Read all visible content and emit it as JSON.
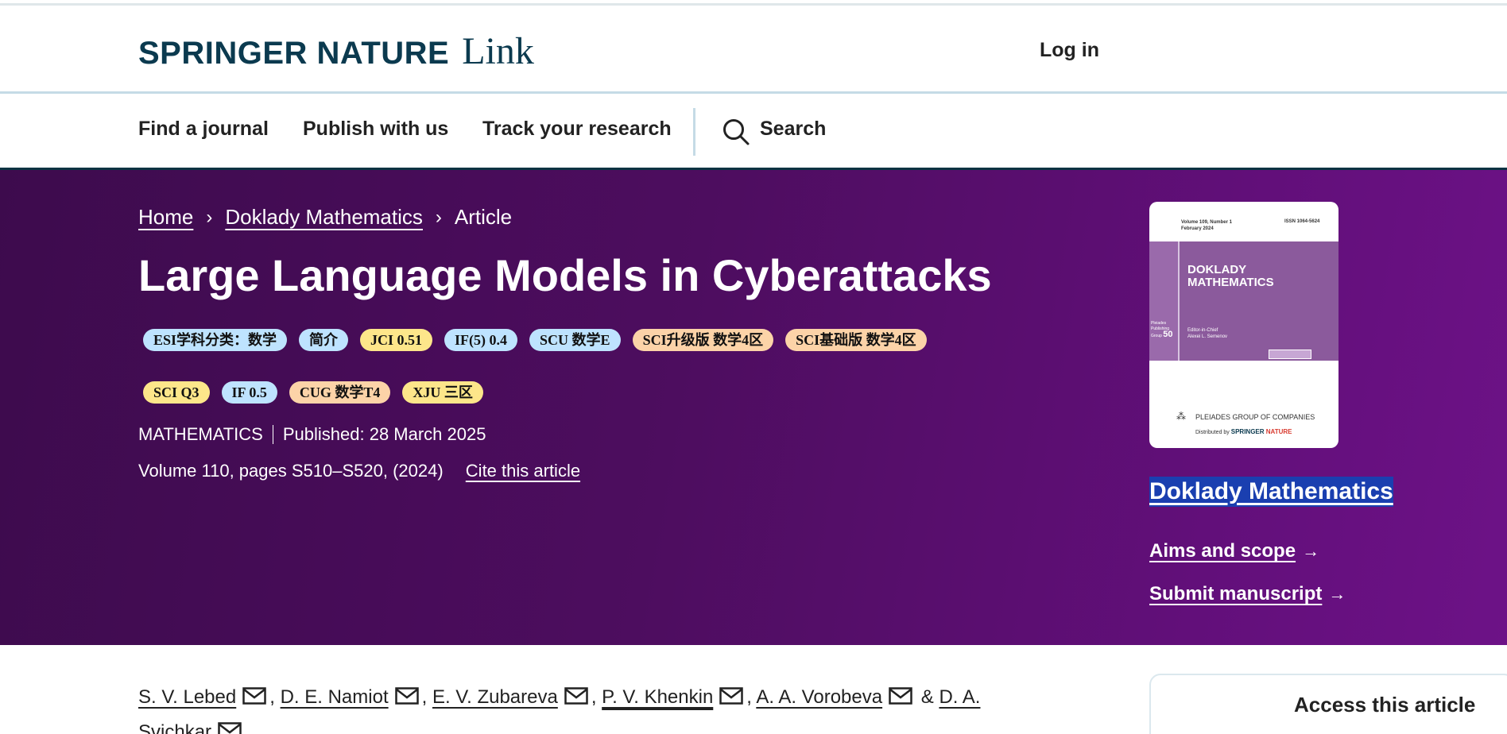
{
  "header": {
    "brand": "SPRINGER NATURE",
    "brand_suffix": "Link",
    "login": "Log in"
  },
  "nav": {
    "items": [
      "Find a journal",
      "Publish with us",
      "Track your research"
    ],
    "search_label": "Search"
  },
  "breadcrumb": [
    "Home",
    "Doklady Mathematics",
    "Article"
  ],
  "article": {
    "title": "Large Language Models in Cyberattacks",
    "subject": "MATHEMATICS",
    "published": "Published: 28 March 2025",
    "volume": "Volume 110, pages S510–S520, (2024)",
    "cite": "Cite this article"
  },
  "badges_row1": [
    {
      "label": "ESI学科分类：数学",
      "color": "#bee3ff"
    },
    {
      "label": "简介",
      "color": "#bee3ff"
    },
    {
      "label": "JCI 0.51",
      "color": "#fde68a"
    },
    {
      "label": "IF(5) 0.4",
      "color": "#bee3ff"
    },
    {
      "label": "SCU 数学E",
      "color": "#bee3ff"
    },
    {
      "label": "SCI升级版 数学4区",
      "color": "#fcd3a8"
    },
    {
      "label": "SCI基础版 数学4区",
      "color": "#fcd3a8"
    }
  ],
  "badges_row2": [
    {
      "label": "SCI Q3",
      "color": "#fde68a"
    },
    {
      "label": "IF 0.5",
      "color": "#bee3ff"
    },
    {
      "label": "CUG 数学T4",
      "color": "#fcd3a8"
    },
    {
      "label": "XJU 三区",
      "color": "#fde68a"
    }
  ],
  "cover": {
    "volume": "Volume 109, Number 1",
    "date": "February 2024",
    "issn": "ISSN 1064-5624",
    "journal": "DOKLADY MATHEMATICS",
    "editor_role": "Editor-in-Chief",
    "editor": "Alexei L. Semenov",
    "pleiades": "PLEIADES GROUP OF COMPANIES",
    "distributed": "Distributed by",
    "springer": "SPRINGER",
    "nature": "NATURE"
  },
  "sidebar": {
    "journal": "Doklady Mathematics",
    "aims": "Aims and scope",
    "submit": "Submit manuscript",
    "access": "Access this article"
  },
  "authors": [
    "S. V. Lebed",
    "D. E. Namiot",
    "E. V. Zubareva",
    "P. V. Khenkin",
    "A. A. Vorobeva",
    "D. A. Svichkar"
  ],
  "author_amp": "&",
  "colors": {
    "hero_start": "#3d0b4d",
    "hero_end": "#6d1287",
    "brand": "#0b3a4f",
    "highlight": "#1a3fb0"
  }
}
